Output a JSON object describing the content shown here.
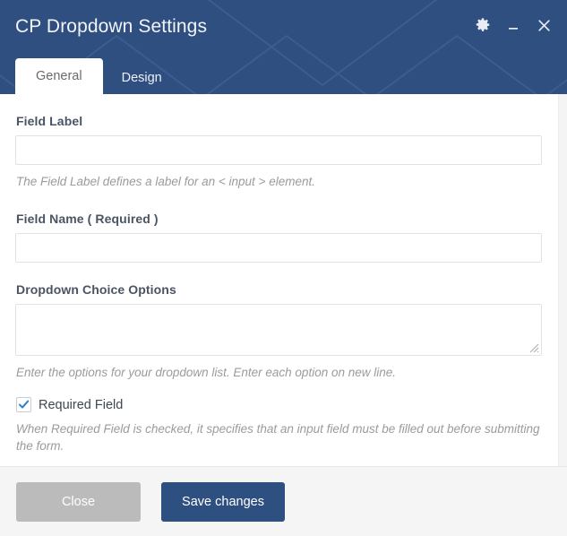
{
  "window": {
    "title": "CP Dropdown Settings",
    "controls": [
      {
        "name": "settings-gear-button",
        "icon": "gear-icon",
        "label": "Settings"
      },
      {
        "name": "minimize-button",
        "icon": "minimize-icon",
        "label": "Minimize"
      },
      {
        "name": "close-window-button",
        "icon": "close-icon",
        "label": "Close"
      }
    ]
  },
  "tabs": [
    {
      "label": "General",
      "active": true
    },
    {
      "label": "Design",
      "active": false
    }
  ],
  "form": {
    "field_label": {
      "label": "Field Label",
      "value": "",
      "placeholder": "",
      "helper": "The Field Label defines a label for an < input > element."
    },
    "field_name": {
      "label": "Field Name ( Required )",
      "value": "",
      "placeholder": "",
      "helper": ""
    },
    "dropdown_options": {
      "label": "Dropdown Choice Options",
      "value": "",
      "placeholder": "",
      "helper": "Enter the options for your dropdown list. Enter each option on new line."
    },
    "required_field": {
      "label": "Required Field",
      "checked": true,
      "helper": "When Required Field is checked, it specifies that an input field must be filled out before submitting the form."
    }
  },
  "footer": {
    "close_label": "Close",
    "save_label": "Save changes"
  },
  "colors": {
    "header_blue": "#2e4f80",
    "accent_blue": "#2e5080",
    "close_gray": "#bbbbbb",
    "footer_bg": "#f5f5f5",
    "checkmark_blue": "#2f7fd0"
  }
}
